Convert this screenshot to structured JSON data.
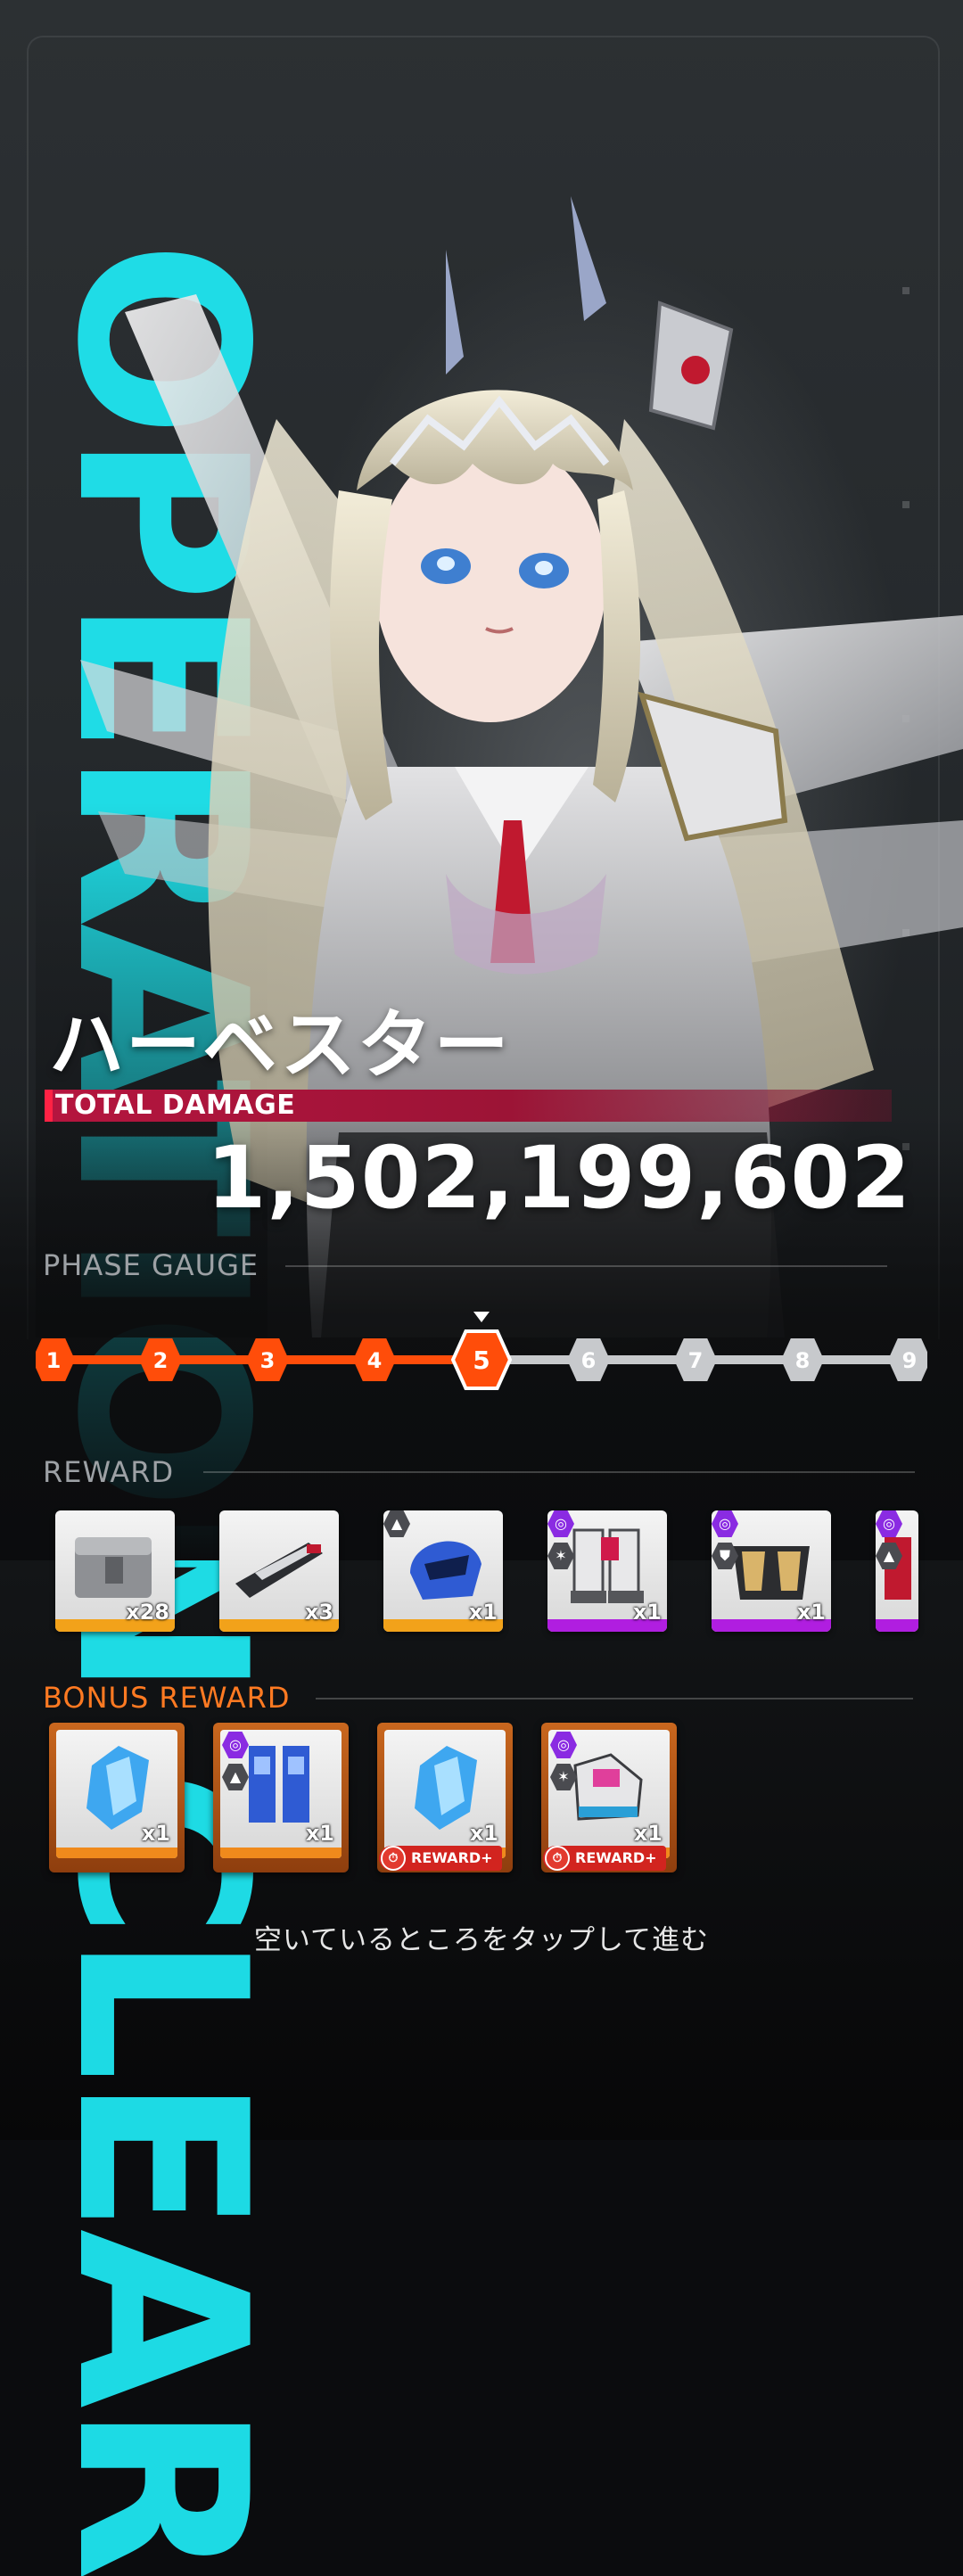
{
  "operation_banner": "OPERATION CLEAR",
  "boss_name": "ハーベスター",
  "total_damage": {
    "label": "TOTAL DAMAGE",
    "value": "1,502,199,602"
  },
  "phase_gauge": {
    "title": "PHASE GAUGE",
    "current_phase": 5,
    "phases": [
      "1",
      "2",
      "3",
      "4",
      "5",
      "6",
      "7",
      "8",
      "9"
    ]
  },
  "reward": {
    "title": "REWARD",
    "items": [
      {
        "name": "supply-crate",
        "qty": "x28",
        "rarity_color": "#f2a21a"
      },
      {
        "name": "weapon-kit",
        "qty": "x3",
        "rarity_color": "#f2a21a"
      },
      {
        "name": "blue-helmet",
        "qty": "x1",
        "rarity_color": "#f2a21a",
        "badges": [
          "up-arrow"
        ]
      },
      {
        "name": "white-armor-boots",
        "qty": "x1",
        "rarity_color": "#b01ee0",
        "badges": [
          "spiral",
          "star"
        ]
      },
      {
        "name": "gold-armor-chest",
        "qty": "x1",
        "rarity_color": "#b01ee0",
        "badges": [
          "spiral",
          "shield"
        ]
      },
      {
        "name": "red-armor-partial",
        "qty": "",
        "rarity_color": "#b01ee0",
        "badges": [
          "spiral",
          "up-arrow"
        ]
      }
    ]
  },
  "bonus_reward": {
    "title": "BONUS REWARD",
    "items": [
      {
        "name": "blue-crystal",
        "qty": "x1",
        "reward_plus": ""
      },
      {
        "name": "blue-armor-legs",
        "qty": "x1",
        "reward_plus": ""
      },
      {
        "name": "blue-crystal",
        "qty": "x1",
        "reward_plus": "REWARD+"
      },
      {
        "name": "pink-armor-boots",
        "qty": "x1",
        "reward_plus": "REWARD+"
      }
    ]
  },
  "tap_hint": "空いているところをタップして進む",
  "colors": {
    "accent_orange": "#ff4d0a",
    "banner_cyan": "#1fe6f0",
    "damage_bar": "#b5153f",
    "rarity_gold": "#f2a21a",
    "rarity_purple": "#b01ee0",
    "gauge_inactive": "#c7c9cc"
  }
}
